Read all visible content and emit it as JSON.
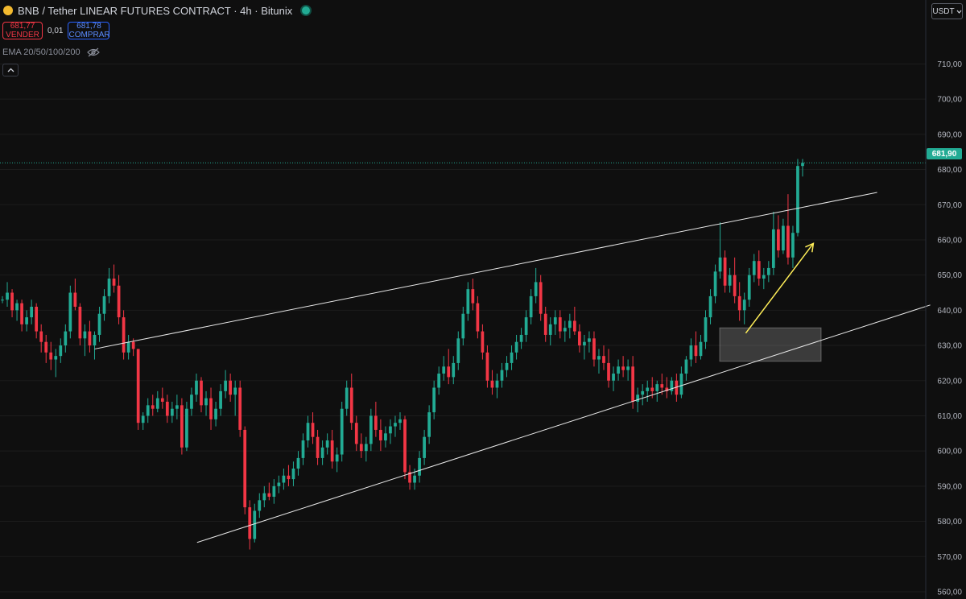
{
  "header": {
    "title": "BNB / Tether LINEAR FUTURES CONTRACT · 4h · Bitunix"
  },
  "trade": {
    "sell_price": "681,77",
    "sell_label": "VENDER",
    "spread": "0,01",
    "buy_price": "681,78",
    "buy_label": "COMPRAR"
  },
  "indicator": {
    "label": "EMA 20/50/100/200"
  },
  "currency": {
    "label": "USDT"
  },
  "last_price": {
    "label": "681,90"
  },
  "colors": {
    "up": "#22ab94",
    "down": "#f23645",
    "background": "#0f0f0f",
    "trendline": "#e8e8e8",
    "arrow": "#ffee58",
    "zone": "#d9d9d9"
  },
  "chart_data": {
    "type": "candlestick",
    "ylim": [
      556,
      718
    ],
    "y_ticks": [
      "710,00",
      "700,00",
      "690,00",
      "680,00",
      "670,00",
      "660,00",
      "650,00",
      "640,00",
      "630,00",
      "620,00",
      "610,00",
      "600,00",
      "590,00",
      "580,00",
      "570,00",
      "560,00"
    ],
    "y_tick_values": [
      710,
      700,
      690,
      680,
      670,
      660,
      650,
      640,
      630,
      620,
      610,
      600,
      590,
      580,
      570,
      560
    ],
    "last_price": 681.9,
    "candles": [
      [
        643,
        644,
        642,
        643
      ],
      [
        643,
        648,
        641,
        645
      ],
      [
        645,
        646,
        638,
        640
      ],
      [
        640,
        643,
        637,
        642
      ],
      [
        642,
        643,
        634,
        636
      ],
      [
        636,
        640,
        634,
        638
      ],
      [
        638,
        643,
        636,
        641
      ],
      [
        641,
        642,
        632,
        634
      ],
      [
        634,
        636,
        628,
        631
      ],
      [
        631,
        633,
        625,
        628
      ],
      [
        628,
        631,
        623,
        626
      ],
      [
        626,
        629,
        621,
        627
      ],
      [
        627,
        632,
        625,
        630
      ],
      [
        630,
        636,
        628,
        634
      ],
      [
        634,
        647,
        632,
        645
      ],
      [
        645,
        649,
        640,
        641
      ],
      [
        641,
        642,
        630,
        632
      ],
      [
        632,
        636,
        627,
        634
      ],
      [
        634,
        637,
        628,
        630
      ],
      [
        630,
        634,
        626,
        633
      ],
      [
        633,
        641,
        631,
        639
      ],
      [
        639,
        646,
        637,
        644
      ],
      [
        644,
        652,
        642,
        649
      ],
      [
        649,
        653,
        645,
        647
      ],
      [
        647,
        650,
        636,
        638
      ],
      [
        638,
        640,
        626,
        628
      ],
      [
        628,
        633,
        626,
        631
      ],
      [
        631,
        632,
        627,
        629
      ],
      [
        629,
        629,
        606,
        608
      ],
      [
        608,
        611,
        606,
        610
      ],
      [
        610,
        615,
        608,
        613
      ],
      [
        613,
        616,
        610,
        612
      ],
      [
        612,
        617,
        611,
        615
      ],
      [
        615,
        618,
        612,
        614
      ],
      [
        614,
        616,
        608,
        610
      ],
      [
        610,
        614,
        608,
        612
      ],
      [
        612,
        616,
        609,
        613
      ],
      [
        613,
        615,
        599,
        601
      ],
      [
        601,
        614,
        600,
        612
      ],
      [
        612,
        618,
        610,
        616
      ],
      [
        616,
        622,
        614,
        620
      ],
      [
        620,
        621,
        611,
        613
      ],
      [
        613,
        617,
        610,
        615
      ],
      [
        615,
        618,
        606,
        609
      ],
      [
        609,
        614,
        607,
        612
      ],
      [
        612,
        619,
        610,
        617
      ],
      [
        617,
        623,
        615,
        620
      ],
      [
        620,
        622,
        614,
        616
      ],
      [
        616,
        620,
        610,
        618
      ],
      [
        618,
        620,
        604,
        606
      ],
      [
        606,
        607,
        582,
        584
      ],
      [
        584,
        586,
        572,
        575
      ],
      [
        575,
        585,
        574,
        583
      ],
      [
        583,
        588,
        581,
        586
      ],
      [
        586,
        590,
        584,
        588
      ],
      [
        588,
        591,
        586,
        587
      ],
      [
        587,
        592,
        585,
        590
      ],
      [
        590,
        593,
        588,
        591
      ],
      [
        591,
        595,
        589,
        593
      ],
      [
        593,
        596,
        590,
        592
      ],
      [
        592,
        597,
        590,
        595
      ],
      [
        595,
        600,
        593,
        598
      ],
      [
        598,
        605,
        596,
        603
      ],
      [
        603,
        610,
        601,
        608
      ],
      [
        608,
        611,
        602,
        604
      ],
      [
        604,
        606,
        596,
        598
      ],
      [
        598,
        603,
        596,
        601
      ],
      [
        601,
        605,
        599,
        603
      ],
      [
        603,
        606,
        595,
        597
      ],
      [
        597,
        601,
        594,
        599
      ],
      [
        599,
        614,
        597,
        612
      ],
      [
        612,
        620,
        610,
        618
      ],
      [
        618,
        622,
        606,
        608
      ],
      [
        608,
        610,
        600,
        602
      ],
      [
        602,
        605,
        598,
        600
      ],
      [
        600,
        604,
        597,
        602
      ],
      [
        602,
        612,
        600,
        610
      ],
      [
        610,
        614,
        604,
        606
      ],
      [
        606,
        609,
        600,
        603
      ],
      [
        603,
        607,
        601,
        605
      ],
      [
        605,
        609,
        602,
        607
      ],
      [
        607,
        610,
        604,
        608
      ],
      [
        608,
        611,
        606,
        609
      ],
      [
        609,
        610,
        592,
        594
      ],
      [
        594,
        596,
        589,
        591
      ],
      [
        591,
        595,
        589,
        593
      ],
      [
        593,
        600,
        591,
        598
      ],
      [
        598,
        606,
        596,
        604
      ],
      [
        604,
        613,
        602,
        611
      ],
      [
        611,
        620,
        609,
        618
      ],
      [
        618,
        624,
        616,
        622
      ],
      [
        622,
        627,
        620,
        624
      ],
      [
        624,
        629,
        619,
        621
      ],
      [
        621,
        627,
        619,
        625
      ],
      [
        625,
        634,
        623,
        632
      ],
      [
        632,
        641,
        630,
        639
      ],
      [
        639,
        648,
        637,
        646
      ],
      [
        646,
        649,
        640,
        642
      ],
      [
        642,
        644,
        632,
        634
      ],
      [
        634,
        636,
        626,
        628
      ],
      [
        628,
        630,
        618,
        620
      ],
      [
        620,
        623,
        616,
        618
      ],
      [
        618,
        622,
        615,
        620
      ],
      [
        620,
        625,
        618,
        623
      ],
      [
        623,
        627,
        621,
        625
      ],
      [
        625,
        630,
        623,
        628
      ],
      [
        628,
        633,
        626,
        631
      ],
      [
        631,
        635,
        629,
        633
      ],
      [
        633,
        640,
        631,
        638
      ],
      [
        638,
        646,
        636,
        644
      ],
      [
        644,
        652,
        642,
        648
      ],
      [
        648,
        650,
        637,
        639
      ],
      [
        639,
        641,
        631,
        633
      ],
      [
        633,
        638,
        630,
        636
      ],
      [
        636,
        640,
        633,
        638
      ],
      [
        638,
        640,
        632,
        634
      ],
      [
        634,
        637,
        631,
        635
      ],
      [
        635,
        639,
        632,
        637
      ],
      [
        637,
        641,
        633,
        634
      ],
      [
        634,
        636,
        628,
        630
      ],
      [
        630,
        633,
        626,
        631
      ],
      [
        631,
        634,
        628,
        632
      ],
      [
        632,
        634,
        624,
        626
      ],
      [
        626,
        629,
        622,
        627
      ],
      [
        627,
        630,
        623,
        625
      ],
      [
        625,
        629,
        618,
        620
      ],
      [
        620,
        624,
        617,
        622
      ],
      [
        622,
        626,
        620,
        624
      ],
      [
        624,
        627,
        621,
        623
      ],
      [
        623,
        626,
        620,
        624
      ],
      [
        624,
        627,
        612,
        614
      ],
      [
        614,
        618,
        611,
        616
      ],
      [
        616,
        619,
        613,
        617
      ],
      [
        617,
        620,
        614,
        618
      ],
      [
        618,
        621,
        615,
        617
      ],
      [
        617,
        620,
        614,
        619
      ],
      [
        619,
        622,
        616,
        618
      ],
      [
        618,
        621,
        615,
        617
      ],
      [
        617,
        621,
        616,
        620
      ],
      [
        620,
        622,
        614,
        616
      ],
      [
        616,
        624,
        615,
        622
      ],
      [
        622,
        627,
        620,
        626
      ],
      [
        626,
        632,
        624,
        630
      ],
      [
        630,
        634,
        625,
        627
      ],
      [
        627,
        633,
        626,
        631
      ],
      [
        631,
        640,
        629,
        638
      ],
      [
        638,
        646,
        636,
        644
      ],
      [
        644,
        653,
        642,
        651
      ],
      [
        651,
        665,
        649,
        655
      ],
      [
        655,
        657,
        645,
        647
      ],
      [
        647,
        652,
        645,
        650
      ],
      [
        650,
        655,
        642,
        644
      ],
      [
        644,
        648,
        637,
        640
      ],
      [
        640,
        645,
        636,
        643
      ],
      [
        643,
        652,
        641,
        650
      ],
      [
        650,
        656,
        648,
        654
      ],
      [
        654,
        657,
        647,
        649
      ],
      [
        649,
        652,
        646,
        650
      ],
      [
        650,
        654,
        648,
        652
      ],
      [
        652,
        668,
        650,
        663
      ],
      [
        663,
        667,
        655,
        657
      ],
      [
        657,
        666,
        656,
        664
      ],
      [
        664,
        673,
        653,
        655
      ],
      [
        655,
        664,
        652,
        662
      ],
      [
        662,
        683,
        661,
        681
      ],
      [
        681,
        683,
        678,
        681.9
      ]
    ],
    "lines": [
      {
        "name": "",
        "points": [
          [
            0.098,
            629.0
          ],
          [
            0.908,
            673.5
          ]
        ]
      },
      {
        "name": "",
        "points": [
          [
            0.204,
            574.0
          ],
          [
            0.963,
            641.5
          ]
        ]
      }
    ],
    "zone": {
      "x0": 0.745,
      "x1": 0.85,
      "y0": 625.5,
      "y1": 635.0
    },
    "arrow": {
      "x0": 0.772,
      "y0": 633.5,
      "x1": 0.842,
      "y1": 659.0
    }
  }
}
